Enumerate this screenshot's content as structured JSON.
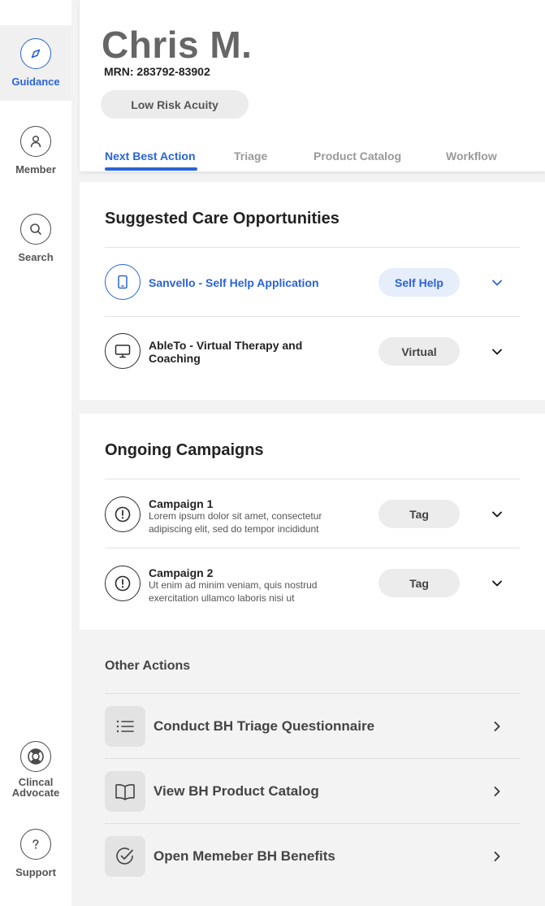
{
  "sidebar": {
    "items": [
      {
        "label": "Guidance",
        "icon": "compass-icon",
        "active": true
      },
      {
        "label": "Member",
        "icon": "person-icon"
      },
      {
        "label": "Search",
        "icon": "search-icon"
      },
      {
        "label": "Clincal\nAdvocate",
        "icon": "lifebuoy-icon"
      },
      {
        "label": "Support",
        "icon": "question-icon"
      }
    ]
  },
  "member": {
    "name": "Chris M.",
    "mrn": "MRN: 283792-83902",
    "acuity": "Low Risk Acuity"
  },
  "tabs": [
    {
      "label": "Next Best Action",
      "active": true
    },
    {
      "label": "Triage"
    },
    {
      "label": "Product Catalog"
    },
    {
      "label": "Workflow"
    }
  ],
  "care": {
    "title": "Suggested Care Opportunities",
    "items": [
      {
        "title": "Sanvello - Self Help Application",
        "tag": "Self Help",
        "icon": "tablet-icon",
        "highlight": true
      },
      {
        "title": "AbleTo - Virtual Therapy and Coaching",
        "tag": "Virtual",
        "icon": "monitor-icon"
      }
    ]
  },
  "campaigns": {
    "title": "Ongoing Campaigns",
    "items": [
      {
        "title": "Campaign 1",
        "desc": "Lorem ipsum dolor sit amet, consectetur adipiscing elit, sed do tempor incididunt",
        "tag": "Tag",
        "icon": "alert-icon"
      },
      {
        "title": "Campaign 2",
        "desc": "Ut enim ad minim veniam, quis nostrud exercitation ullamco laboris nisi ut",
        "tag": "Tag",
        "icon": "alert-icon"
      }
    ]
  },
  "other_actions": {
    "title": "Other Actions",
    "items": [
      {
        "label": "Conduct BH Triage Questionnaire",
        "icon": "list-icon"
      },
      {
        "label": "View BH Product Catalog",
        "icon": "book-icon"
      },
      {
        "label": "Open Memeber BH Benefits",
        "icon": "check-circle-icon"
      }
    ]
  },
  "colors": {
    "accent": "#2a63d9",
    "accent_light": "#e6edfb",
    "background": "#f3f3f3",
    "pill": "#ececec"
  }
}
